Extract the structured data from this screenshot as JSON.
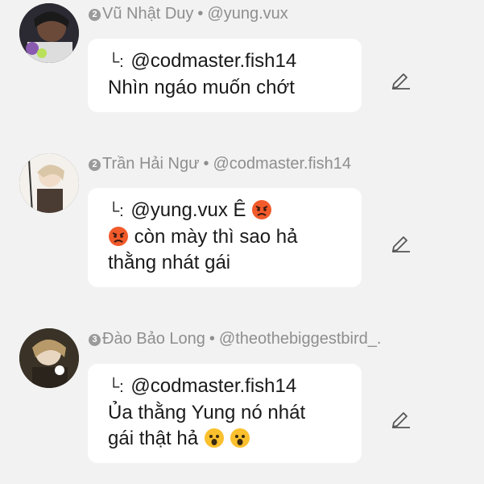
{
  "comments": [
    {
      "badge": "2",
      "name": "Vũ Nhật Duy",
      "separator": "•",
      "handle": "@yung.vux",
      "reply_prefix": "└:",
      "reply_to": "@codmaster.fish14",
      "text": "Nhìn ngáo muốn chớt"
    },
    {
      "badge": "2",
      "name": "Trần Hải Ngư",
      "separator": "•",
      "handle": "@codmaster.fish14",
      "reply_prefix": "└:",
      "reply_to": "@yung.vux",
      "text_a": "Ê",
      "text_b": "còn mày thì sao hả",
      "text_c": "thằng nhát gái"
    },
    {
      "badge": "3",
      "name": "Đào Bảo Long",
      "separator": "•",
      "handle": "@theothebiggestbird_.",
      "reply_prefix": "└:",
      "reply_to": "@codmaster.fish14",
      "text_a": "Ủa thằng Yung nó nhát",
      "text_b": "gái thật hả"
    }
  ],
  "icons": {
    "edit": "pencil-edit-icon",
    "angry": "angry-face-emoji",
    "surprised": "anguished-face-emoji"
  },
  "colors": {
    "background": "#f2f2f2",
    "bubble": "#ffffff",
    "meta_text": "#8e8e8e"
  }
}
